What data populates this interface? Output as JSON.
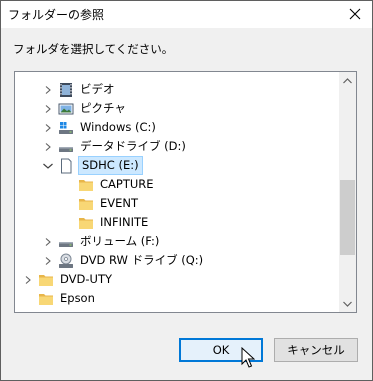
{
  "window": {
    "title": "フォルダーの参照",
    "instruction": "フォルダを選択してください。"
  },
  "tree": {
    "items": [
      {
        "label": "ビデオ",
        "icon": "video-icon"
      },
      {
        "label": "ピクチャ",
        "icon": "pictures-icon"
      },
      {
        "label": "Windows (C:)",
        "icon": "windows-drive-icon"
      },
      {
        "label": "データドライブ (D:)",
        "icon": "drive-icon"
      },
      {
        "label": "SDHC (E:)",
        "icon": "sd-card-icon",
        "selected": true,
        "expanded": true
      },
      {
        "label": "CAPTURE",
        "icon": "folder-icon"
      },
      {
        "label": "EVENT",
        "icon": "folder-icon"
      },
      {
        "label": "INFINITE",
        "icon": "folder-icon"
      },
      {
        "label": "ボリューム (F:)",
        "icon": "drive-icon"
      },
      {
        "label": "DVD RW ドライブ (Q:)",
        "icon": "dvd-drive-icon"
      },
      {
        "label": "DVD-UTY",
        "icon": "folder-icon"
      },
      {
        "label": "Epson",
        "icon": "folder-icon"
      }
    ]
  },
  "buttons": {
    "ok": "OK",
    "cancel": "キャンセル"
  },
  "colors": {
    "selection": "#cce8ff",
    "accent": "#0078d7",
    "folder": "#f8d775"
  }
}
